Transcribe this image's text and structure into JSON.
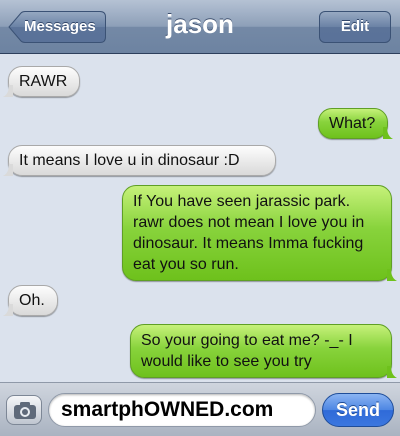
{
  "header": {
    "back_label": "Messages",
    "title": "jason",
    "edit_label": "Edit"
  },
  "messages": [
    {
      "side": "received",
      "text": "RAWR"
    },
    {
      "side": "sent",
      "text": "What?"
    },
    {
      "side": "received",
      "text": "It means I love u in dinosaur :D"
    },
    {
      "side": "sent",
      "text": "If You have seen jarassic park. rawr does not mean I love you in dinosaur. It means Imma fucking eat you so run."
    },
    {
      "side": "received",
      "text": "Oh."
    },
    {
      "side": "sent",
      "text": "So your going to eat me? -_- I would like to see you try"
    }
  ],
  "composer": {
    "camera_icon": "camera-icon",
    "field_text": "smartphOWNED.com",
    "send_label": "Send"
  },
  "colors": {
    "received_bubble": "#e6e6e6",
    "sent_bubble": "#88d33c",
    "background": "#dbe2ed",
    "send_button": "#3b77df"
  }
}
